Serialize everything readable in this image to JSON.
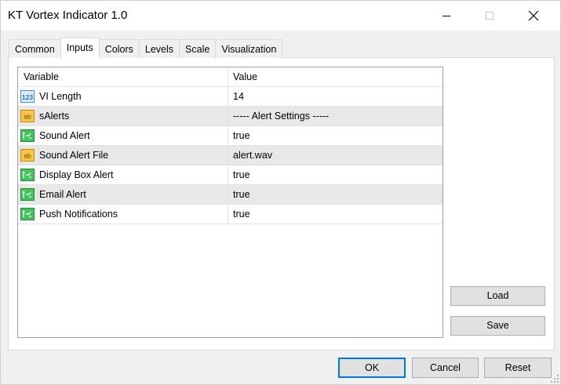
{
  "window": {
    "title": "KT Vortex Indicator 1.0"
  },
  "tabs": [
    {
      "label": "Common",
      "active": false
    },
    {
      "label": "Inputs",
      "active": true
    },
    {
      "label": "Colors",
      "active": false
    },
    {
      "label": "Levels",
      "active": false
    },
    {
      "label": "Scale",
      "active": false
    },
    {
      "label": "Visualization",
      "active": false
    }
  ],
  "grid": {
    "columns": [
      "Variable",
      "Value"
    ],
    "rows": [
      {
        "icon": "numeric-123-icon",
        "variable": "VI Length",
        "value": "14"
      },
      {
        "icon": "string-ab-icon",
        "variable": "sAlerts",
        "value": "----- Alert Settings -----"
      },
      {
        "icon": "boolean-icon",
        "variable": "Sound Alert",
        "value": "true"
      },
      {
        "icon": "string-ab-icon",
        "variable": "Sound Alert File",
        "value": "alert.wav"
      },
      {
        "icon": "boolean-icon",
        "variable": "Display Box Alert",
        "value": "true"
      },
      {
        "icon": "boolean-icon",
        "variable": "Email Alert",
        "value": "true"
      },
      {
        "icon": "boolean-icon",
        "variable": "Push Notifications",
        "value": "true"
      }
    ]
  },
  "side_buttons": {
    "load": "Load",
    "save": "Save"
  },
  "footer_buttons": {
    "ok": "OK",
    "cancel": "Cancel",
    "reset": "Reset"
  },
  "colors": {
    "accent": "#0078d7",
    "row_alt": "#e8e8e8",
    "numeric_icon": "#3d8fd6",
    "string_icon": "#f0b321",
    "boolean_icon": "#2fb24a"
  }
}
